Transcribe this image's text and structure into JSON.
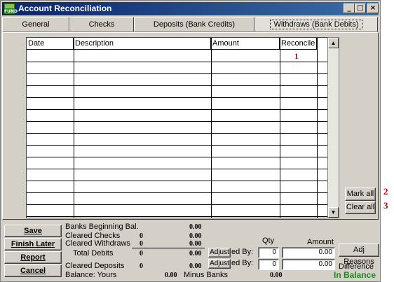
{
  "window": {
    "title": "Account Reconciliation",
    "icon_text": "FUND",
    "controls": {
      "minimize": "_",
      "maximize": "□",
      "close": "×"
    }
  },
  "tabs": [
    {
      "label": "General"
    },
    {
      "label": "Checks"
    },
    {
      "label": "Deposits (Bank Credits)"
    },
    {
      "label": "Withdraws (Bank Debits)"
    }
  ],
  "grid": {
    "columns": [
      "Date",
      "Description",
      "Amount",
      "Reconcile"
    ],
    "first_row_reconcile": "1"
  },
  "side_buttons": {
    "mark_all": "Mark all",
    "clear_all": "Clear all"
  },
  "markers": {
    "mark_all": "2",
    "clear_all": "3"
  },
  "actions": {
    "save": "Save",
    "finish_later": "Finish Later",
    "report": "Report",
    "cancel": "Cancel"
  },
  "summary": {
    "banks_beginning_label": "Banks Beginning Bal.",
    "banks_beginning_value": "0.00",
    "cleared_checks_label": "Cleared Checks",
    "cleared_checks_count": "0",
    "cleared_checks_value": "0.00",
    "cleared_withdraws_label": "Cleared Withdraws",
    "cleared_withdraws_count": "0",
    "cleared_withdraws_value": "0.00",
    "total_debits_label": "Total Debits",
    "total_debits_count": "0",
    "total_debits_value": "0.00",
    "cleared_deposits_label": "Cleared Deposits",
    "cleared_deposits_count": "0",
    "cleared_deposits_value": "0.00",
    "balance_yours_label": "Balance: Yours",
    "balance_yours_value": "0.00",
    "minus_banks_label": "Minus Banks",
    "minus_banks_value": "0.00"
  },
  "adjust": {
    "button_label": "Adjust",
    "row1_label": "ed By:",
    "row2_label": "ed By:",
    "qty_header": "Qty",
    "amount_header": "Amount",
    "row1_qty": "0",
    "row1_amount": "0.00",
    "row2_qty": "0",
    "row2_amount": "0.00",
    "adj_reasons": "Adj Reasons",
    "difference_label": "Difference",
    "status": "In Balance"
  }
}
